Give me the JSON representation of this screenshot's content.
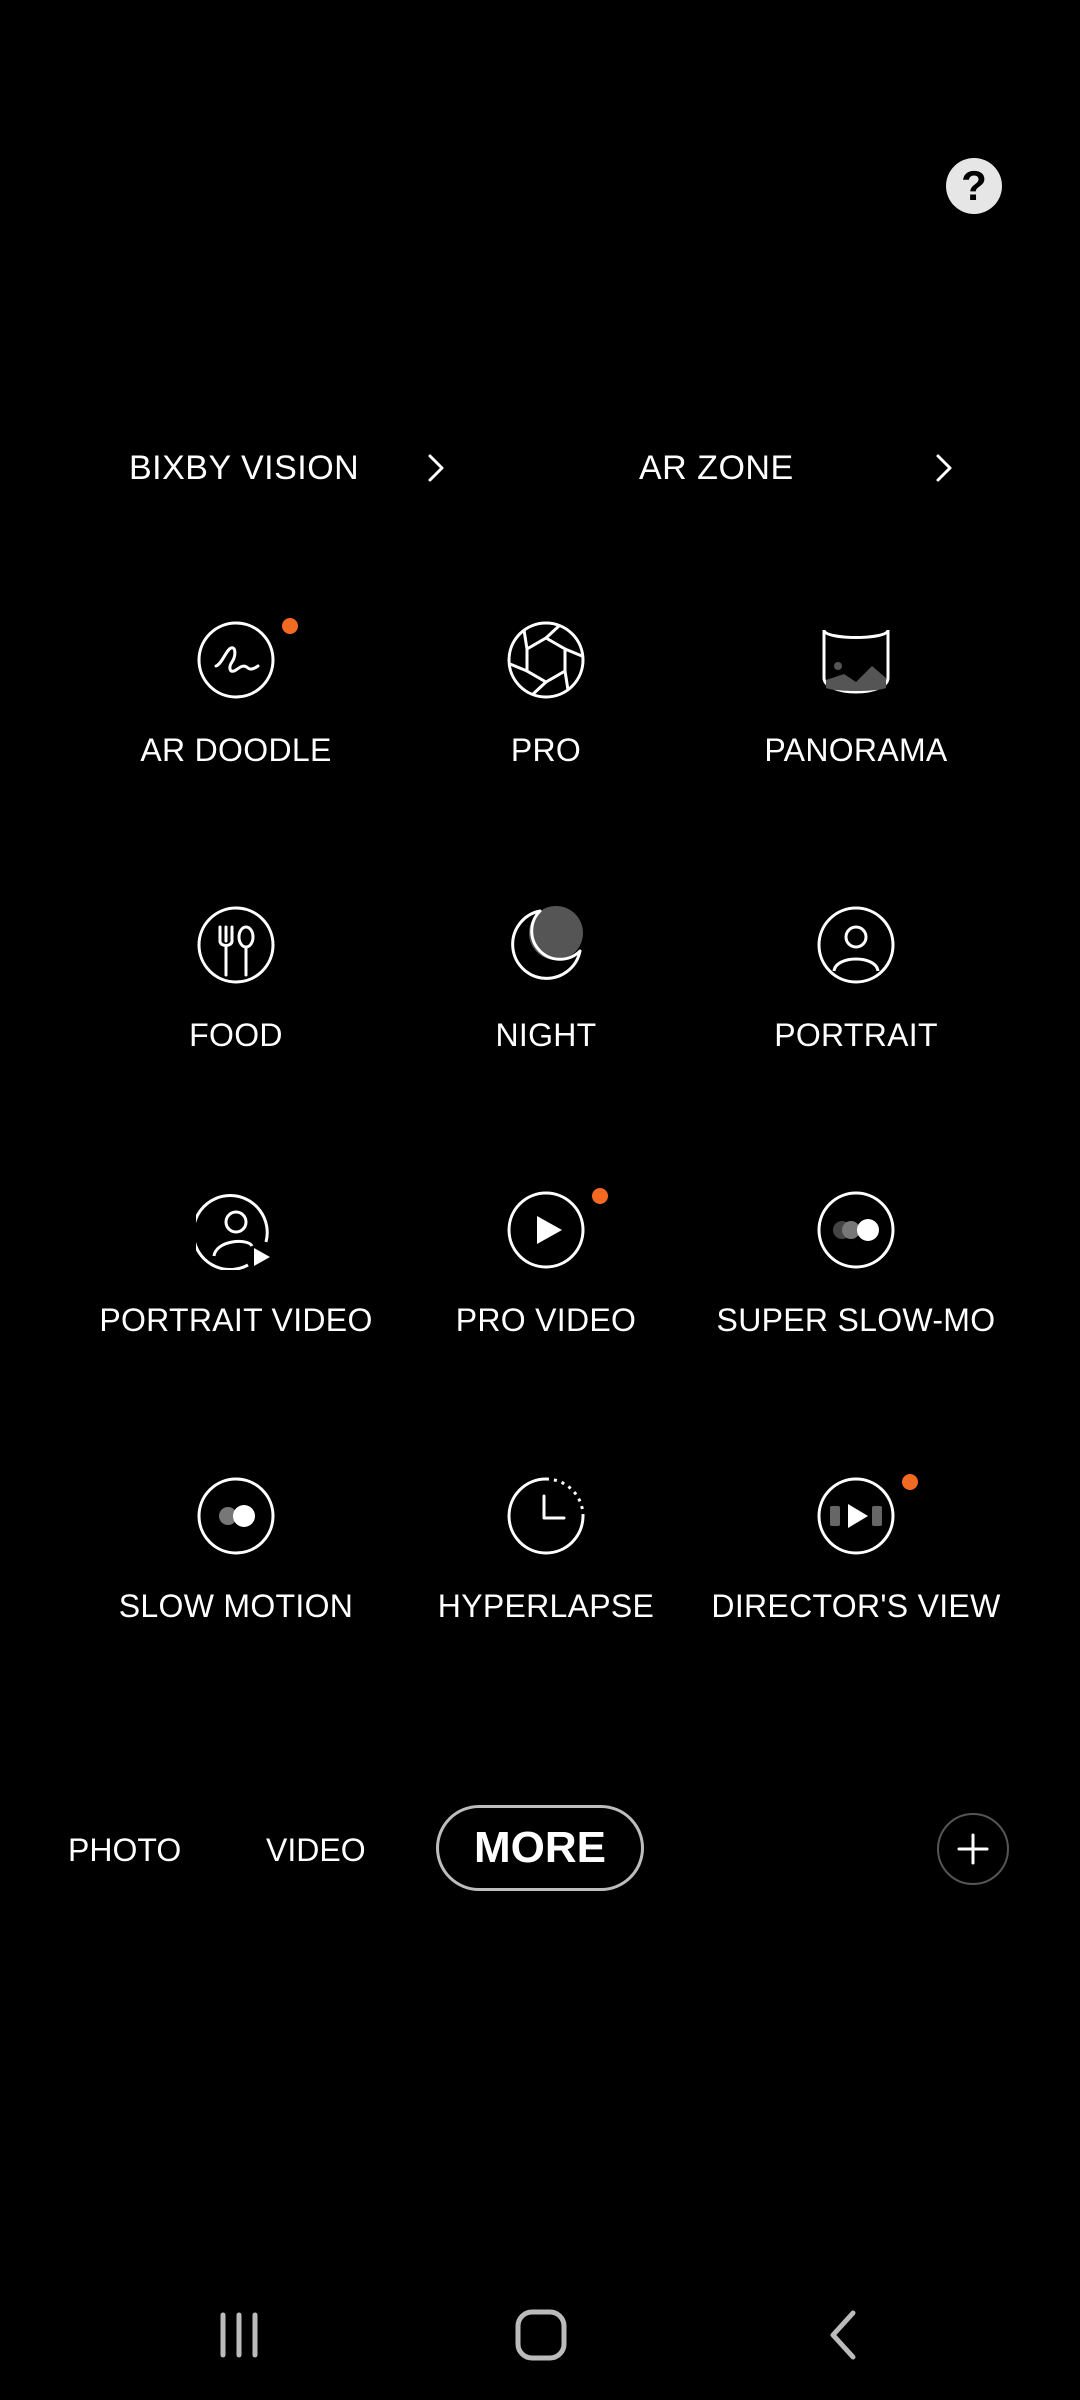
{
  "top_bar": {
    "help_symbol": "?",
    "help_icon": "question-mark-icon"
  },
  "links": [
    {
      "label": "BIXBY VISION",
      "icon": "chevron-right-icon"
    },
    {
      "label": "AR ZONE",
      "icon": "chevron-right-icon"
    }
  ],
  "modes": [
    {
      "label": "AR DOODLE",
      "icon": "ar-doodle-icon",
      "new_badge": true
    },
    {
      "label": "PRO",
      "icon": "aperture-icon",
      "new_badge": false
    },
    {
      "label": "PANORAMA",
      "icon": "panorama-icon",
      "new_badge": false
    },
    {
      "label": "FOOD",
      "icon": "fork-spoon-icon",
      "new_badge": false
    },
    {
      "label": "NIGHT",
      "icon": "moon-icon",
      "new_badge": false
    },
    {
      "label": "PORTRAIT",
      "icon": "person-icon",
      "new_badge": false
    },
    {
      "label": "PORTRAIT VIDEO",
      "icon": "person-play-icon",
      "new_badge": false
    },
    {
      "label": "PRO VIDEO",
      "icon": "play-icon",
      "new_badge": true
    },
    {
      "label": "SUPER SLOW-MO",
      "icon": "super-slow-mo-icon",
      "new_badge": false
    },
    {
      "label": "SLOW MOTION",
      "icon": "slow-motion-icon",
      "new_badge": false
    },
    {
      "label": "HYPERLAPSE",
      "icon": "hyperlapse-clock-icon",
      "new_badge": false
    },
    {
      "label": "DIRECTOR'S VIEW",
      "icon": "directors-view-icon",
      "new_badge": true
    }
  ],
  "tabs": {
    "photo": "PHOTO",
    "video": "VIDEO",
    "more": "MORE"
  },
  "add_icon": "plus-icon",
  "nav": {
    "recents_icon": "recent-apps-icon",
    "home_icon": "home-icon",
    "back_icon": "back-icon"
  },
  "colors": {
    "background": "#000000",
    "badge": "#f26a22",
    "more_border": "#bdbdbd"
  }
}
